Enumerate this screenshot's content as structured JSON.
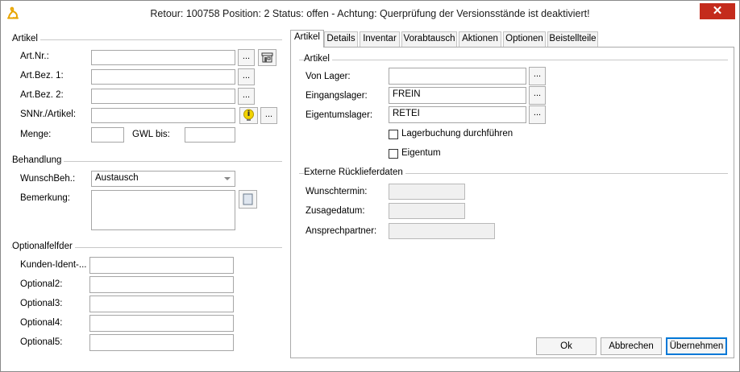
{
  "window": {
    "title": "Retour: 100758 Position: 2 Status: offen - Achtung: Querprüfung der Versionsstände ist deaktiviert!",
    "close_glyph": "✕"
  },
  "left": {
    "artikel": {
      "group_title": "Artikel",
      "artnr_label": "Art.Nr.:",
      "artnr_value": "",
      "artbez1_label": "Art.Bez. 1:",
      "artbez1_value": "",
      "artbez2_label": "Art.Bez. 2:",
      "artbez2_value": "",
      "snnr_label": "SNNr./Artikel:",
      "snnr_value": "",
      "menge_label": "Menge:",
      "menge_value": "",
      "gwl_label": "GWL bis:",
      "gwl_value": ""
    },
    "behandlung": {
      "group_title": "Behandlung",
      "wunschbeh_label": "WunschBeh.:",
      "wunschbeh_value": "Austausch",
      "bemerkung_label": "Bemerkung:"
    },
    "optionalfelder": {
      "group_title": "Optionalfelfder",
      "fields": [
        {
          "label": "Kunden-Ident-...",
          "value": ""
        },
        {
          "label": "Optional2:",
          "value": ""
        },
        {
          "label": "Optional3:",
          "value": ""
        },
        {
          "label": "Optional4:",
          "value": ""
        },
        {
          "label": "Optional5:",
          "value": ""
        }
      ]
    },
    "dots": "..."
  },
  "tabs": [
    "Artikel",
    "Details",
    "Inventar",
    "Vorabtausch",
    "Aktionen",
    "Optionen",
    "Beistellteile"
  ],
  "active_tab": "Artikel",
  "panel": {
    "artikel": {
      "group_title": "Artikel",
      "von_lager_label": "Von Lager:",
      "von_lager_value": "",
      "eingangslager_label": "Eingangslager:",
      "eingangslager_value": "FREIN",
      "eigentumslager_label": "Eigentumslager:",
      "eigentumslager_value": "RETEI",
      "lagerbuchung_label": "Lagerbuchung durchführen",
      "lagerbuchung_checked": false,
      "eigentum_label": "Eigentum",
      "eigentum_checked": false
    },
    "extern": {
      "group_title": "Externe Rücklieferdaten",
      "wunschtermin_label": "Wunschtermin:",
      "zusagedatum_label": "Zusagedatum:",
      "ansprechpartner_label": "Ansprechpartner:"
    }
  },
  "buttons": {
    "ok": "Ok",
    "abbrechen": "Abbrechen",
    "uebernehmen": "Übernehmen"
  },
  "colors": {
    "close_red": "#c42b1c",
    "default_border": "#0078d7",
    "app_icon": "#e8a500"
  }
}
